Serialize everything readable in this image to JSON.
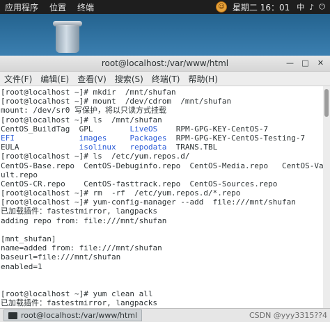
{
  "topbar": {
    "apps": "应用程序",
    "places": "位置",
    "terminal": "终端",
    "clock": "星期二 16：01"
  },
  "window": {
    "title": "root@localhost:/var/www/html",
    "menu": [
      "文件(F)",
      "编辑(E)",
      "查看(V)",
      "搜索(S)",
      "终端(T)",
      "帮助(H)"
    ]
  },
  "terminal": {
    "lines": [
      "[root@localhost ~]# mkdir  /mnt/shufan",
      "[root@localhost ~]# mount  /dev/cdrom  /mnt/shufan",
      "mount: /dev/sr0 写保护，将以只读方式挂载",
      "[root@localhost ~]# ls  /mnt/shufan",
      "CentOS_BuildTag  GPL        LiveOS    RPM-GPG-KEY-CentOS-7",
      "EFI              images     Packages  RPM-GPG-KEY-CentOS-Testing-7",
      "EULA             isolinux   repodata  TRANS.TBL",
      "[root@localhost ~]# ls  /etc/yum.repos.d/",
      "CentOS-Base.repo  CentOS-Debuginfo.repo  CentOS-Media.repo   CentOS-Va",
      "ult.repo",
      "CentOS-CR.repo    CentOS-fasttrack.repo  CentOS-Sources.repo",
      "[root@localhost ~]# rm  -rf  /etc/yum.repos.d/*.repo",
      "[root@localhost ~]# yum-config-manager --add  file:///mnt/shufan",
      "已加载插件：fastestmirror, langpacks",
      "adding repo from: file:///mnt/shufan",
      "",
      "[mnt_shufan]",
      "name=added from: file:///mnt/shufan",
      "baseurl=file:///mnt/shufan",
      "enabled=1",
      "",
      "",
      "[root@localhost ~]# yum clean all",
      "已加载插件：fastestmirror, langpacks"
    ],
    "blue_entries": [
      "LiveOS",
      "EFI",
      "images",
      "Packages",
      "isolinux",
      "repodata"
    ]
  },
  "taskbar": {
    "task_label": "root@localhost:/var/www/html",
    "watermark": "CSDN @yyy3315??4"
  }
}
